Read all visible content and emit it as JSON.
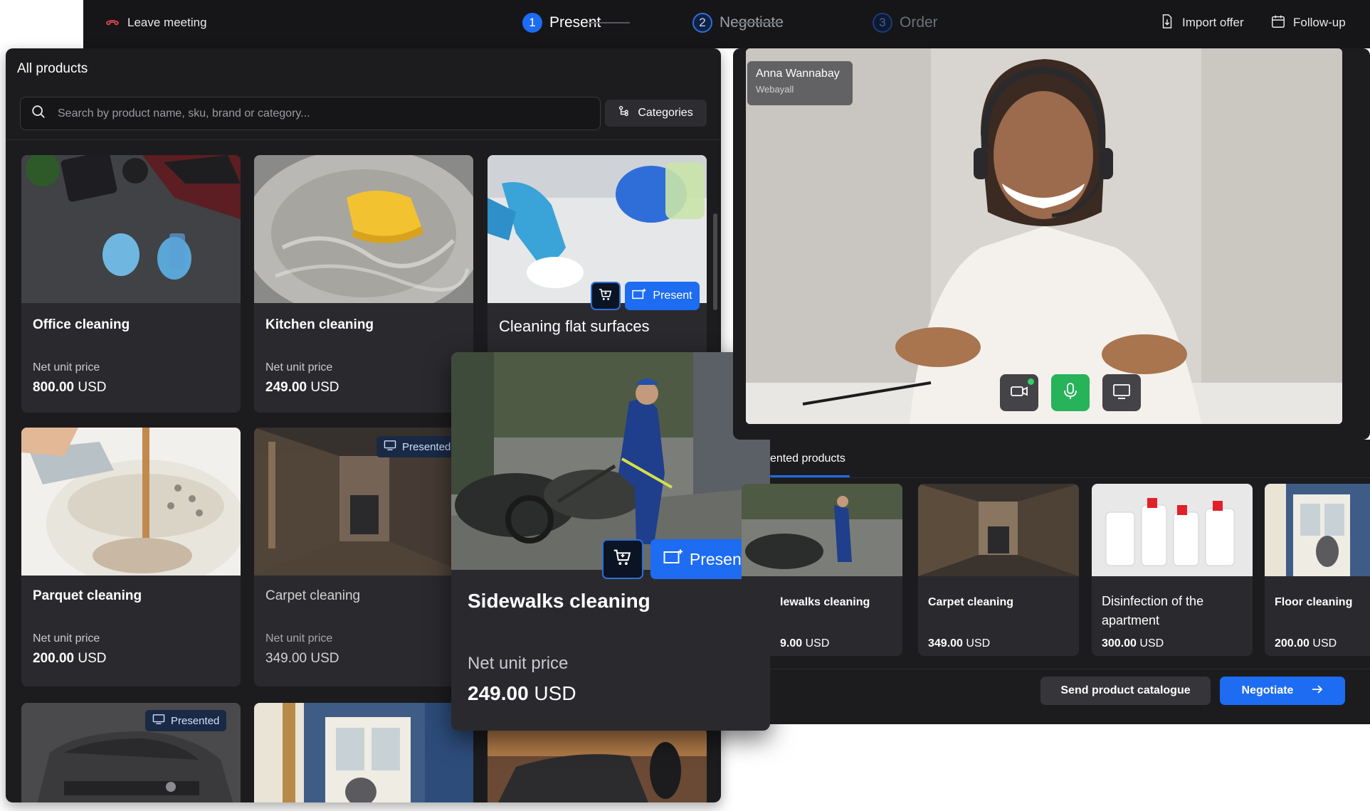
{
  "topbar": {
    "leave_label": "Leave meeting",
    "steps": [
      {
        "number": "1",
        "label": "Present"
      },
      {
        "number": "2",
        "label": "Negotiate"
      },
      {
        "number": "3",
        "label": "Order"
      }
    ],
    "import_label": "Import offer",
    "followup_label": "Follow-up"
  },
  "products": {
    "title": "All products",
    "search_placeholder": "Search by product name, sku, brand or category...",
    "categories_label": "Categories",
    "price_label": "Net unit price",
    "presented_badge": "Presented",
    "present_button": "Present",
    "cards": [
      {
        "name": "Office cleaning",
        "price": "800.00",
        "currency": "USD"
      },
      {
        "name": "Kitchen cleaning",
        "price": "249.00",
        "currency": "USD"
      },
      {
        "name": "Cleaning flat surfaces"
      },
      {
        "name": "Parquet cleaning",
        "price": "200.00",
        "currency": "USD"
      },
      {
        "name": "Carpet cleaning",
        "price": "349.00",
        "currency": "USD"
      }
    ]
  },
  "floating_card": {
    "name": "Sidewalks cleaning",
    "price_label": "Net unit price",
    "price": "249.00",
    "currency": "USD",
    "present_button": "Present"
  },
  "video": {
    "participant_name": "Anna Wannabay",
    "participant_company": "Webayall"
  },
  "presented_products": {
    "title": "ented products",
    "items": [
      {
        "name": "lewalks cleaning",
        "price": "9.00",
        "currency": "USD"
      },
      {
        "name": "Carpet cleaning",
        "price": "349.00",
        "currency": "USD"
      },
      {
        "name": "Disinfection of the apartment",
        "price": "300.00",
        "currency": "USD"
      },
      {
        "name": "Floor cleaning",
        "price": "200.00",
        "currency": "USD"
      }
    ],
    "send_label": "Send product catalogue",
    "negotiate_label": "Negotiate"
  },
  "colors": {
    "accent": "#1d6cf2",
    "panel": "#1c1c1e",
    "card": "#2a2a2e",
    "mic_active": "#27b35a"
  }
}
